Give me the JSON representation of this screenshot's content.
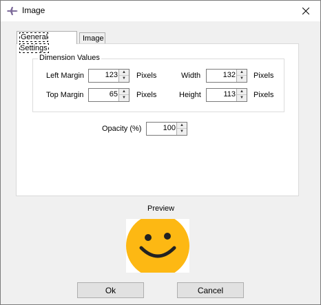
{
  "window": {
    "title": "Image"
  },
  "icons": {
    "app": "airplane-icon",
    "close": "close-icon",
    "up": "spin-up-arrow",
    "down": "spin-down-arrow"
  },
  "tabs": [
    {
      "label": "General Settings",
      "active": true
    },
    {
      "label": "Image",
      "active": false
    }
  ],
  "dimension_group": {
    "title": "Dimension Values",
    "left_margin": {
      "label": "Left Margin",
      "value": "123",
      "unit": "Pixels"
    },
    "top_margin": {
      "label": "Top Margin",
      "value": "65",
      "unit": "Pixels"
    },
    "width": {
      "label": "Width",
      "value": "132",
      "unit": "Pixels"
    },
    "height": {
      "label": "Height",
      "value": "113",
      "unit": "Pixels"
    }
  },
  "opacity": {
    "label": "Opacity (%)",
    "value": "100"
  },
  "preview": {
    "label": "Preview",
    "image": "smiley-face"
  },
  "buttons": {
    "ok": "Ok",
    "cancel": "Cancel"
  },
  "colors": {
    "accent_icon": "#7d6b9a",
    "smiley": "#fdb813"
  }
}
